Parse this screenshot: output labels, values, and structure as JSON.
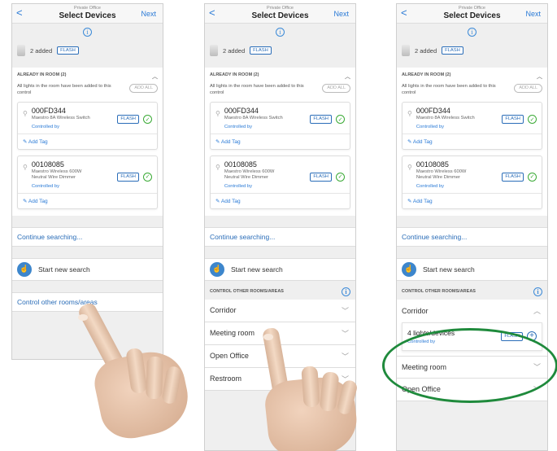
{
  "screens": [
    {
      "nav": {
        "back": "<",
        "subtitle": "Private Office",
        "title": "Select Devices",
        "next": "Next"
      },
      "added": {
        "text": "2 added",
        "flash": "FLASH"
      },
      "already": {
        "header": "ALREADY IN ROOM (2)",
        "desc": "All lights in the room have been added to this control",
        "add_all": "ADD ALL",
        "devices": [
          {
            "id": "000FD344",
            "name": "Maestro 8A Wireless Switch",
            "controlled": "Controlled by",
            "flash": "FLASH",
            "tag": "Add Tag"
          },
          {
            "id": "00108085",
            "name": "Maestro Wireless 600W Neutral Wire Dimmer",
            "controlled": "Controlled by",
            "flash": "FLASH",
            "tag": "Add Tag"
          }
        ]
      },
      "continue": "Continue searching...",
      "start": "Start new search",
      "control_other": "Control other rooms/areas"
    },
    {
      "nav": {
        "back": "<",
        "subtitle": "Private Office",
        "title": "Select Devices",
        "next": "Next"
      },
      "added": {
        "text": "2 added",
        "flash": "FLASH"
      },
      "already": {
        "header": "ALREADY IN ROOM (2)",
        "desc": "All lights in the room have been added to this control",
        "add_all": "ADD ALL",
        "devices": [
          {
            "id": "000FD344",
            "name": "Maestro 8A Wireless Switch",
            "controlled": "Controlled by",
            "flash": "FLASH",
            "tag": "Add Tag"
          },
          {
            "id": "00108085",
            "name": "Maestro Wireless 600W Neutral Wire Dimmer",
            "controlled": "Controlled by",
            "flash": "FLASH",
            "tag": "Add Tag"
          }
        ]
      },
      "continue": "Continue searching...",
      "start": "Start new search",
      "control_header": "CONTROL OTHER ROOMS/AREAS",
      "rooms": [
        "Corridor",
        "Meeting room",
        "Open Office",
        "Restroom"
      ]
    },
    {
      "nav": {
        "back": "<",
        "subtitle": "Private Office",
        "title": "Select Devices",
        "next": "Next"
      },
      "added": {
        "text": "2 added",
        "flash": "FLASH"
      },
      "already": {
        "header": "ALREADY IN ROOM (2)",
        "desc": "All lights in the room have been added to this control",
        "add_all": "ADD ALL",
        "devices": [
          {
            "id": "000FD344",
            "name": "Maestro 8A Wireless Switch",
            "controlled": "Controlled by",
            "flash": "FLASH",
            "tag": "Add Tag"
          },
          {
            "id": "00108085",
            "name": "Maestro Wireless 600W Neutral Wire Dimmer",
            "controlled": "Controlled by",
            "flash": "FLASH",
            "tag": "Add Tag"
          }
        ]
      },
      "continue": "Continue searching...",
      "start": "Start new search",
      "control_header": "CONTROL OTHER ROOMS/AREAS",
      "expanded_room": {
        "name": "Corridor",
        "detail": "4 lights/devices",
        "controlled": "Controlled by",
        "flash": "FLASH"
      },
      "rooms": [
        "Meeting room",
        "Open Office"
      ]
    }
  ],
  "colors": {
    "accent": "#2a7ad6",
    "success": "#3aaa35",
    "highlight_ring": "#1f8a3c"
  }
}
